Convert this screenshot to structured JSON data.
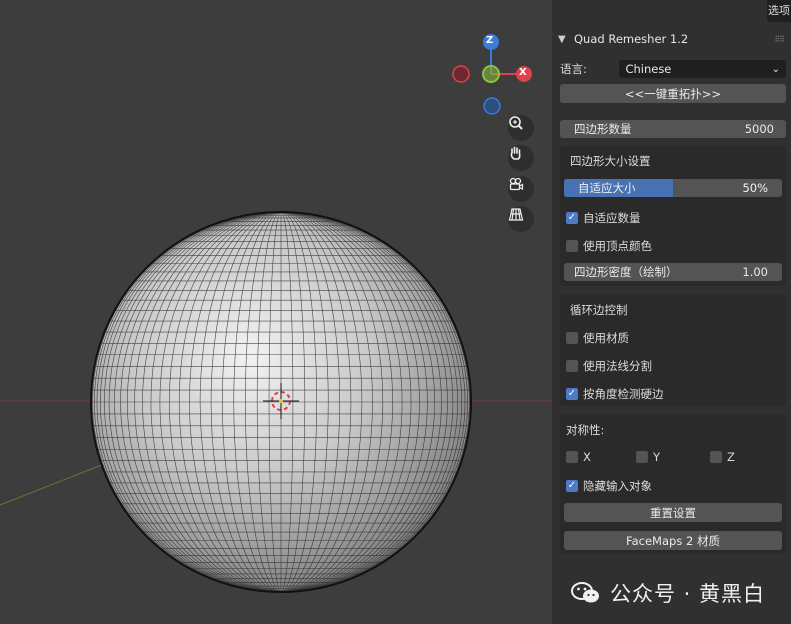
{
  "top_tab": "选项",
  "panel": {
    "title": "Quad Remesher 1.2",
    "language_label": "语言:",
    "language_value": "Chinese",
    "remesh_button": "<<一键重拓扑>>",
    "quad_count_label": "四边形数量",
    "quad_count_value": "5000"
  },
  "quad_size": {
    "title": "四边形大小设置",
    "adaptive_size_label": "自适应大小",
    "adaptive_size_value": "50%",
    "adaptive_size_fraction": 0.5,
    "adaptive_quantity_label": "自适应数量",
    "adaptive_quantity_checked": true,
    "vertex_color_label": "使用顶点颜色",
    "vertex_color_checked": false,
    "density_label": "四边形密度（绘制）",
    "density_value": "1.00"
  },
  "edge_loops": {
    "title": "循环边控制",
    "materials_label": "使用材质",
    "materials_checked": false,
    "normals_label": "使用法线分割",
    "normals_checked": false,
    "angle_label": "按角度检测硬边",
    "angle_checked": true
  },
  "symmetry": {
    "title": "对称性:",
    "x_label": "X",
    "y_label": "Y",
    "z_label": "Z",
    "hide_input_label": "隐藏输入对象",
    "hide_input_checked": true,
    "reset_button": "重置设置",
    "facemaps_button": "FaceMaps 2 材质"
  },
  "gizmo": {
    "z": "Z",
    "x": "X"
  },
  "watermark": "公众号 · 黄黑白",
  "colors": {
    "axis_x": "#e0414f",
    "axis_y": "#8bc33a",
    "axis_z": "#3a7dd8",
    "accent": "#4772b3"
  }
}
